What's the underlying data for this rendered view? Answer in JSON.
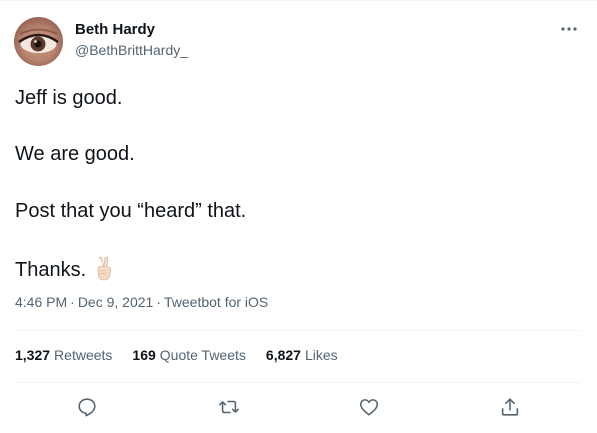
{
  "author": {
    "name": "Beth Hardy",
    "handle": "@BethBrittHardy_"
  },
  "tweet": {
    "lines": [
      "Jeff is good.",
      "We are good.",
      "Post that you “heard” that.",
      "Thanks."
    ],
    "emoji_icon": "victory-hand-icon",
    "time": "4:46 PM",
    "date": "Dec 9, 2021",
    "separator": "·",
    "source": "Tweetbot for iOS"
  },
  "stats": {
    "retweets_count": "1,327",
    "retweets_label": "Retweets",
    "quotes_count": "169",
    "quotes_label": "Quote Tweets",
    "likes_count": "6,827",
    "likes_label": "Likes"
  },
  "actions": {
    "reply_icon": "reply-icon",
    "retweet_icon": "retweet-icon",
    "like_icon": "heart-icon",
    "share_icon": "share-icon",
    "more_icon": "more-icon"
  },
  "colors": {
    "text_primary": "#0f1419",
    "text_secondary": "#536471",
    "divider": "#eff3f4"
  }
}
